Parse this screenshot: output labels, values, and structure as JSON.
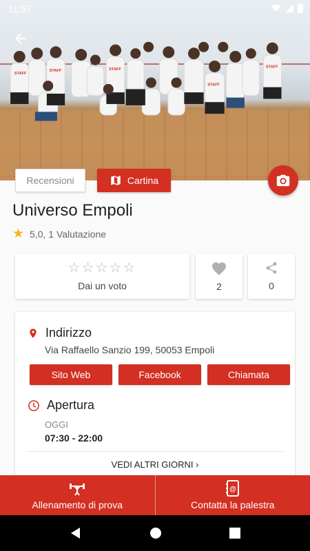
{
  "status_bar": {
    "time": "11:57"
  },
  "hero": {
    "alt_description": ""
  },
  "tabs": {
    "reviews_label": "Recensioni",
    "map_label": "Cartina"
  },
  "gym": {
    "name": "Universo Empoli",
    "rating_text": "5,0, 1 Valutazione"
  },
  "actions": {
    "vote_label": "Dai un voto",
    "likes_count": "2",
    "shares_count": "0"
  },
  "address": {
    "heading": "Indirizzo",
    "text": "Via Raffaello Sanzio 199, 50053  Empoli",
    "buttons": [
      "Sito Web",
      "Facebook",
      "Chiamata"
    ]
  },
  "opening": {
    "heading": "Apertura",
    "today_label": "OGGI",
    "today_hours": "07:30 - 22:00",
    "more_days_label": "VEDI ALTRI GIORNI"
  },
  "bottom_bar": {
    "trial_label": "Allenamento di prova",
    "contact_label": "Contatta la palestra"
  },
  "colors": {
    "accent": "#d32f22",
    "star": "#f5b623"
  }
}
